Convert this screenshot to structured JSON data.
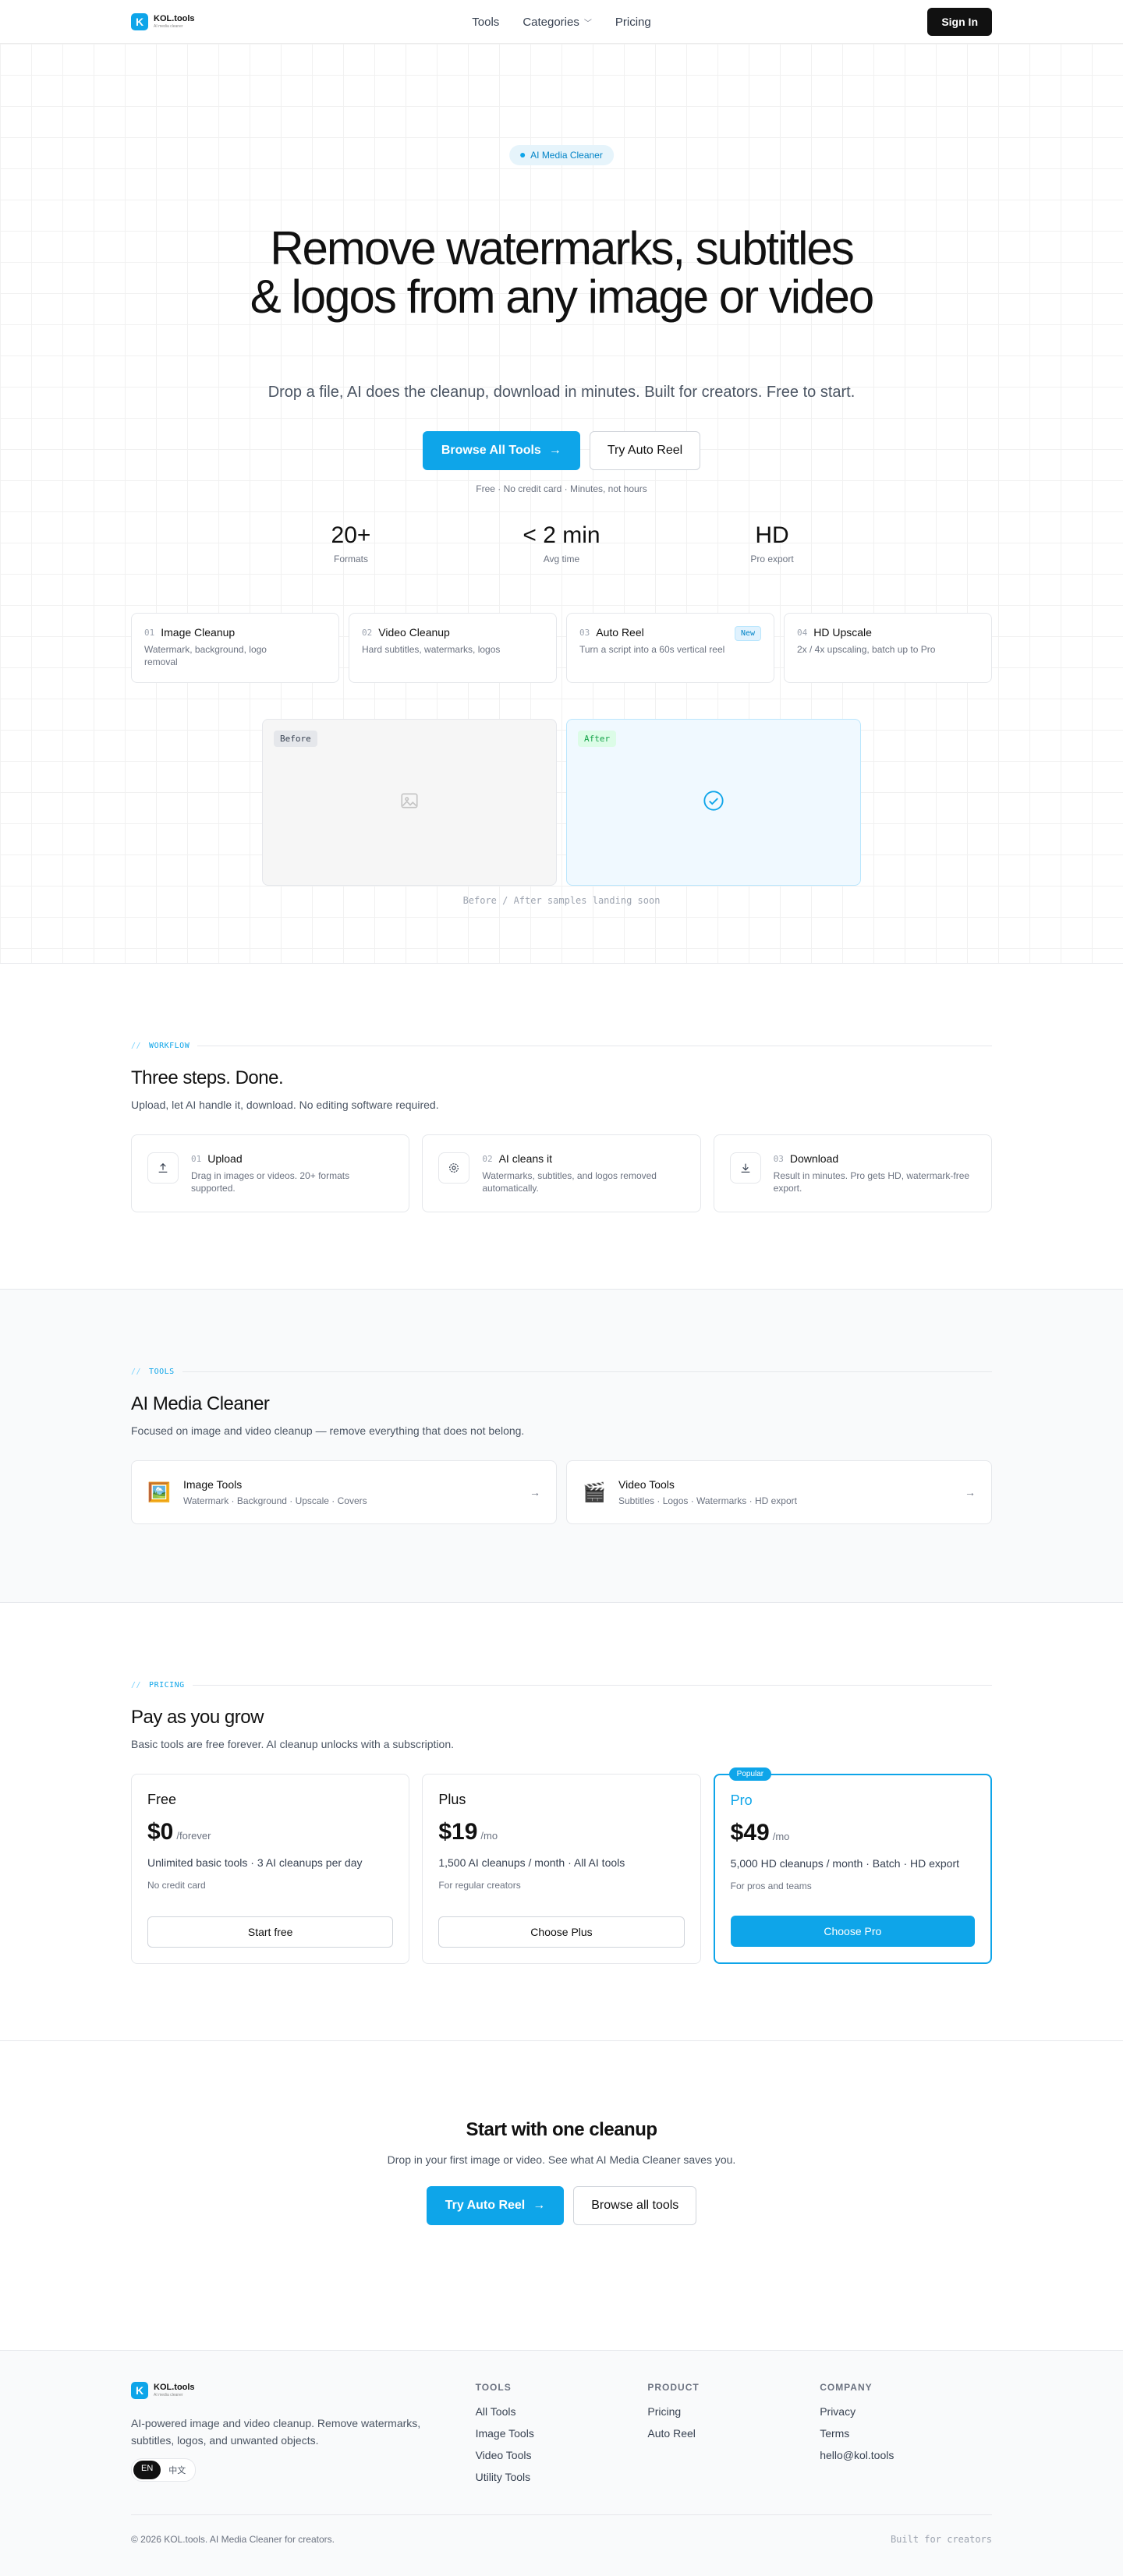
{
  "brand": {
    "name": "KOL.tools",
    "tagline": "AI media cleaner",
    "mark": "K",
    "accent": "#0ea5e9"
  },
  "nav": {
    "links": [
      "Tools",
      "Categories",
      "Pricing"
    ],
    "signin": "Sign In"
  },
  "hero": {
    "badge": "AI Media Cleaner",
    "title": "Remove watermarks, subtitles & logos from any image or video",
    "subtitle": "Drop a file, AI does the cleanup, download in minutes. Built for creators. Free to start.",
    "primary_cta": "Browse All Tools",
    "secondary_cta": "Try Auto Reel",
    "note": "Free · No credit card · Minutes, not hours",
    "stats": [
      {
        "value": "20+",
        "label": "Formats"
      },
      {
        "value": "< 2 min",
        "label": "Avg time"
      },
      {
        "value": "HD",
        "label": "Pro export"
      }
    ],
    "features": [
      {
        "num": "01",
        "title": "Image Cleanup",
        "desc": "Watermark, background, logo removal"
      },
      {
        "num": "02",
        "title": "Video Cleanup",
        "desc": "Hard subtitles, watermarks, logos"
      },
      {
        "num": "03",
        "title": "Auto Reel",
        "desc": "Turn a script into a 60s vertical reel",
        "badge": "New"
      },
      {
        "num": "04",
        "title": "HD Upscale",
        "desc": "2x / 4x upscaling, batch up to Pro"
      }
    ],
    "before_label": "Before",
    "after_label": "After",
    "compare_note": "Before / After samples landing soon"
  },
  "workflow": {
    "eyebrow": "WORKFLOW",
    "title": "Three steps. Done.",
    "subtitle": "Upload, let AI handle it, download. No editing software required.",
    "steps": [
      {
        "num": "01",
        "title": "Upload",
        "desc": "Drag in images or videos. 20+ formats supported.",
        "icon": "upload-icon"
      },
      {
        "num": "02",
        "title": "AI cleans it",
        "desc": "Watermarks, subtitles, and logos removed automatically.",
        "icon": "gear-icon"
      },
      {
        "num": "03",
        "title": "Download",
        "desc": "Result in minutes. Pro gets HD, watermark-free export.",
        "icon": "download-icon"
      }
    ]
  },
  "tools": {
    "eyebrow": "TOOLS",
    "title": "AI Media Cleaner",
    "subtitle": "Focused on image and video cleanup — remove everything that does not belong.",
    "cards": [
      {
        "icon": "🖼️",
        "title": "Image Tools",
        "desc": "Watermark · Background · Upscale · Covers",
        "arrow": "→"
      },
      {
        "icon": "🎬",
        "title": "Video Tools",
        "desc": "Subtitles · Logos · Watermarks · HD export",
        "arrow": "→"
      }
    ]
  },
  "pricing": {
    "eyebrow": "PRICING",
    "title": "Pay as you grow",
    "subtitle": "Basic tools are free forever. AI cleanup unlocks with a subscription.",
    "plans": [
      {
        "name": "Free",
        "price": "$0",
        "per": "/forever",
        "features": "Unlimited basic tools · 3 AI cleanups per day",
        "note": "No credit card",
        "cta": "Start free"
      },
      {
        "name": "Plus",
        "price": "$19",
        "per": "/mo",
        "features": "1,500 AI cleanups / month · All AI tools",
        "note": "For regular creators",
        "cta": "Choose Plus"
      },
      {
        "name": "Pro",
        "price": "$49",
        "per": "/mo",
        "features": "5,000 HD cleanups / month · Batch · HD export",
        "note": "For pros and teams",
        "cta": "Choose Pro",
        "badge": "Popular"
      }
    ]
  },
  "cta": {
    "title": "Start with one cleanup",
    "subtitle": "Drop in your first image or video. See what AI Media Cleaner saves you.",
    "primary": "Try Auto Reel",
    "secondary": "Browse all tools"
  },
  "footer": {
    "desc": "AI-powered image and video cleanup. Remove watermarks, subtitles, logos, and unwanted objects.",
    "lang": [
      "EN",
      "中文"
    ],
    "columns": [
      {
        "heading": "TOOLS",
        "links": [
          "All Tools",
          "Image Tools",
          "Video Tools",
          "Utility Tools"
        ]
      },
      {
        "heading": "PRODUCT",
        "links": [
          "Pricing",
          "Auto Reel"
        ]
      },
      {
        "heading": "COMPANY",
        "links": [
          "Privacy",
          "Terms",
          "hello@kol.tools"
        ]
      }
    ],
    "copyright": "© 2026 KOL.tools. AI Media Cleaner for creators.",
    "built": "Built for creators"
  }
}
